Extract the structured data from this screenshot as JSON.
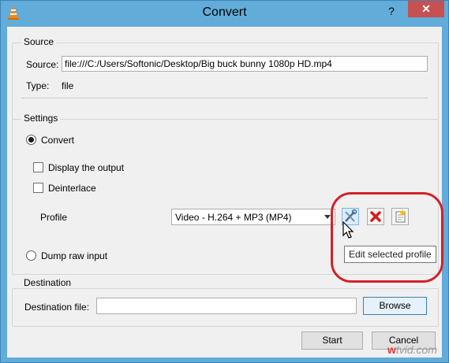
{
  "window": {
    "title": "Convert",
    "help_label": "?",
    "close_label": "✕",
    "app_icon": "vlc-cone-icon"
  },
  "source": {
    "group_title": "Source",
    "source_label": "Source:",
    "source_value": "file:///C:/Users/Softonic/Desktop/Big buck bunny 1080p HD.mp4",
    "type_label": "Type:",
    "type_value": "file"
  },
  "settings": {
    "group_title": "Settings",
    "convert_label": "Convert",
    "convert_selected": true,
    "display_output_label": "Display the output",
    "display_output_checked": false,
    "deinterlace_label": "Deinterlace",
    "deinterlace_checked": false,
    "profile_label": "Profile",
    "profile_value": "Video - H.264 + MP3 (MP4)",
    "tools": [
      "edit-profile-icon",
      "delete-profile-icon",
      "new-profile-icon"
    ],
    "tooltip": "Edit selected profile",
    "dump_raw_label": "Dump raw input",
    "dump_raw_selected": false
  },
  "destination": {
    "group_title": "Destination",
    "file_label": "Destination file:",
    "file_value": "",
    "browse_label": "Browse"
  },
  "buttons": {
    "start_label": "Start",
    "cancel_label": "Cancel"
  },
  "watermark": {
    "prefix": "w",
    "rest": "tvid.com"
  },
  "colors": {
    "title_bar": "#62acd9",
    "close_button": "#c75050",
    "highlight_circle": "#d4202a"
  }
}
